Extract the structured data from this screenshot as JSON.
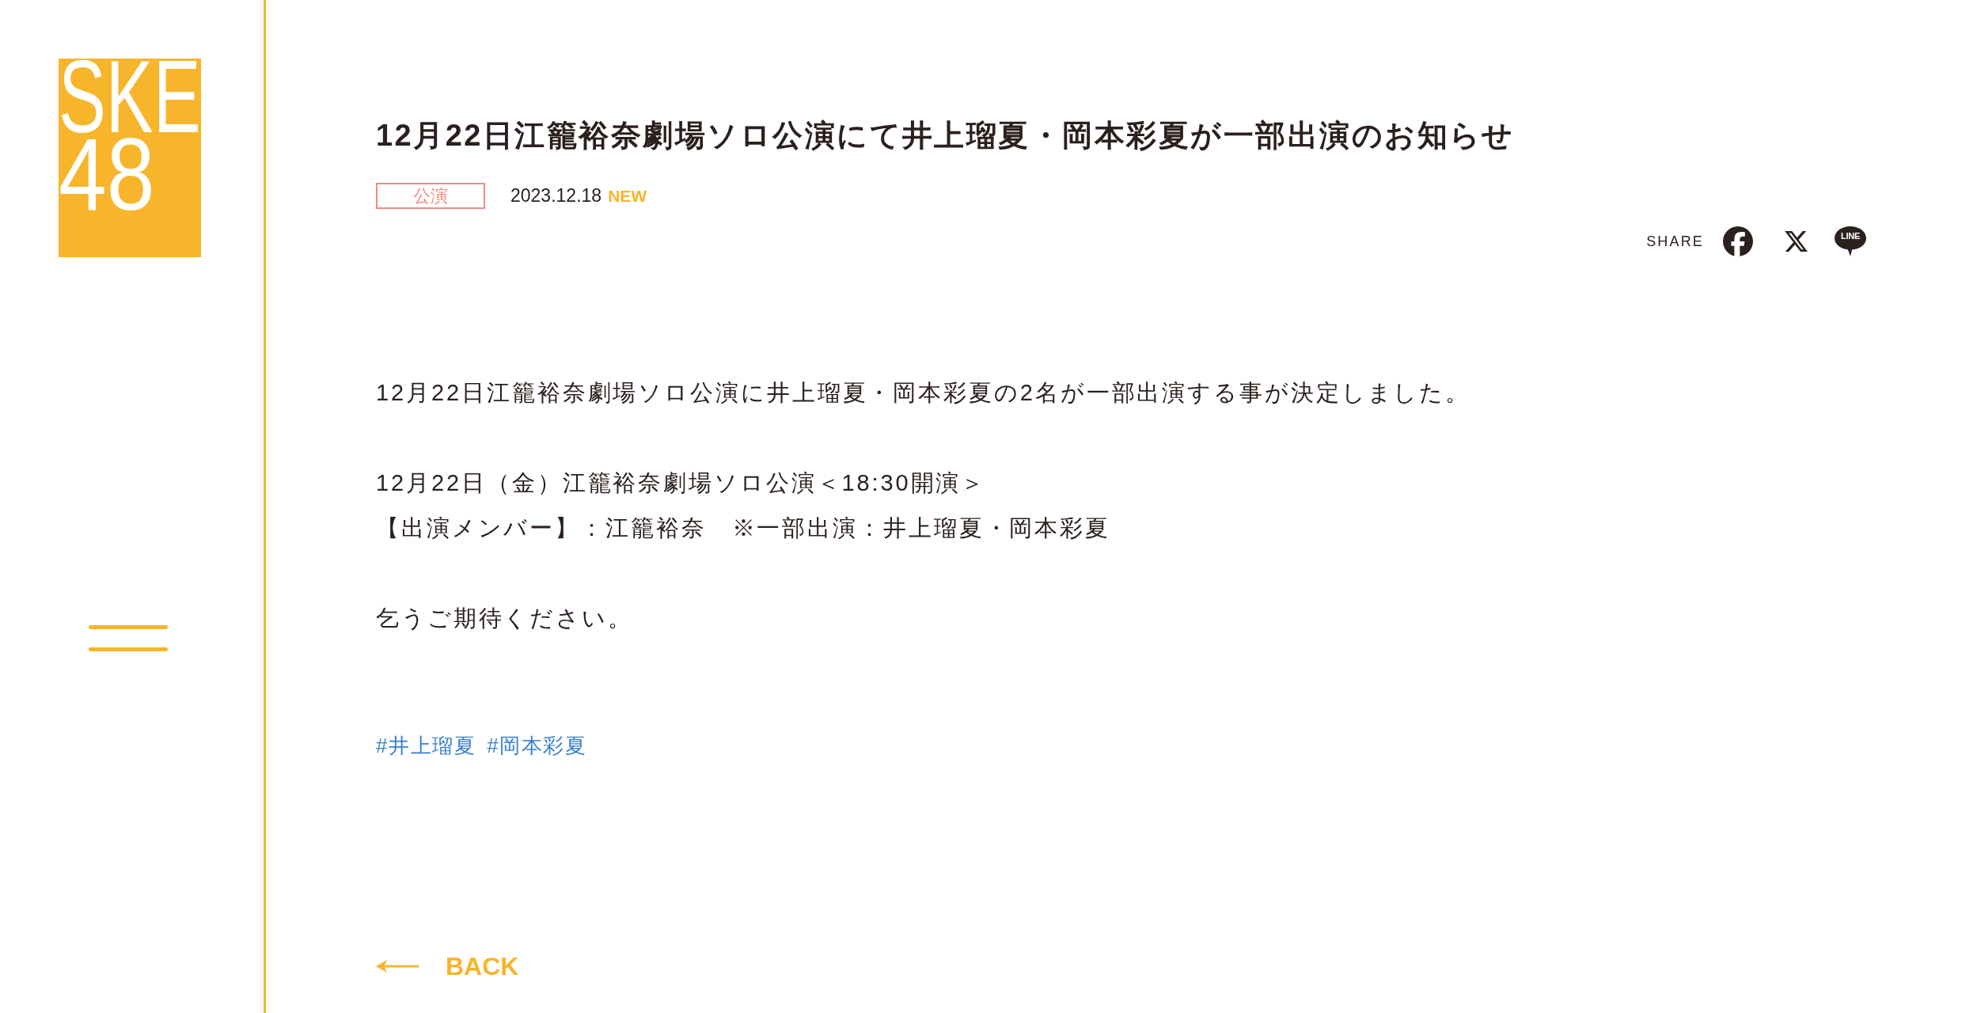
{
  "logo": {
    "line_1": "SKE",
    "line_2": "48"
  },
  "article": {
    "title": "12月22日江籠裕奈劇場ソロ公演にて井上瑠夏・岡本彩夏が一部出演のお知らせ",
    "category": "公演",
    "date": "2023.12.18",
    "badge": "NEW"
  },
  "share": {
    "label": "SHARE",
    "buttons": [
      {
        "kind": "facebook"
      },
      {
        "kind": "x"
      },
      {
        "kind": "line",
        "label": "LINE"
      }
    ]
  },
  "body": {
    "paragraphs": [
      [
        "12月22日江籠裕奈劇場ソロ公演に井上瑠夏・岡本彩夏の2名が一部出演する事が決定しました。"
      ],
      [
        "12月22日（金）江籠裕奈劇場ソロ公演＜18:30開演＞",
        "【出演メンバー】：江籠裕奈　※一部出演：井上瑠夏・岡本彩夏"
      ],
      [
        "乞うご期待ください。"
      ]
    ]
  },
  "hashtags": [
    "#井上瑠夏",
    "#岡本彩夏"
  ],
  "back_link": {
    "label": "BACK"
  }
}
